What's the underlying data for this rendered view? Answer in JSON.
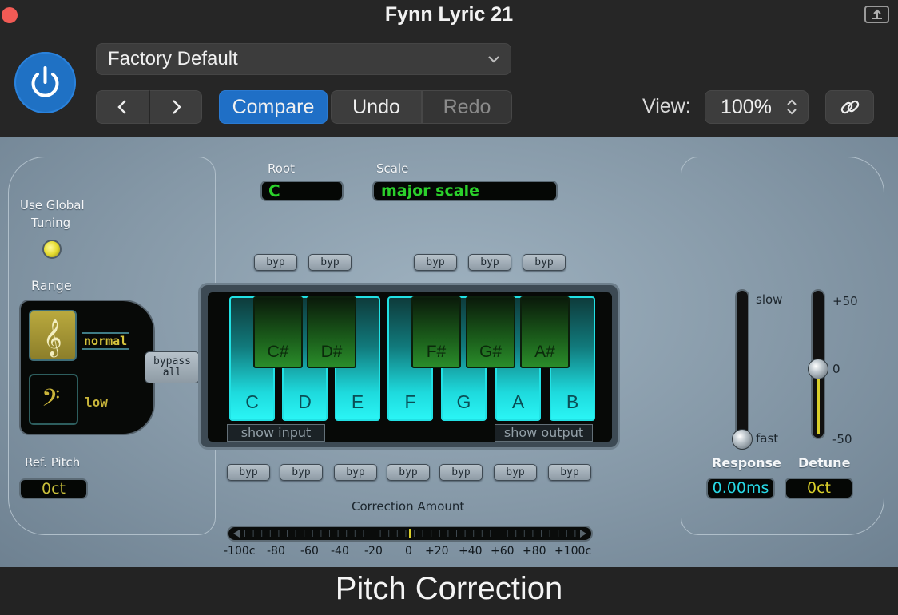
{
  "window": {
    "title": "Fynn Lyric 21"
  },
  "header": {
    "preset": "Factory Default",
    "compare_label": "Compare",
    "undo_label": "Undo",
    "redo_label": "Redo",
    "view_label": "View:",
    "zoom_value": "100%"
  },
  "plugin": {
    "name": "Pitch Correction",
    "root_label": "Root",
    "root_value": "C",
    "scale_label": "Scale",
    "scale_value": "major scale",
    "global_tuning_label_1": "Use Global",
    "global_tuning_label_2": "Tuning",
    "range_label": "Range",
    "range_normal": "normal",
    "range_low": "low",
    "ref_pitch_label": "Ref. Pitch",
    "ref_pitch_value": "0ct",
    "bypass_all_1": "bypass",
    "bypass_all_2": "all",
    "byp_label": "byp",
    "white_keys": [
      "C",
      "D",
      "E",
      "F",
      "G",
      "A",
      "B"
    ],
    "black_keys": [
      "C#",
      "D#",
      "F#",
      "G#",
      "A#"
    ],
    "show_input": "show input",
    "show_output": "show output",
    "response": {
      "label": "Response",
      "value": "0.00ms",
      "slow": "slow",
      "fast": "fast"
    },
    "detune": {
      "label": "Detune",
      "value": "0ct",
      "plus": "+50",
      "zero": "0",
      "minus": "-50"
    },
    "correction": {
      "label": "Correction Amount",
      "ticks": [
        "-100c",
        "-80",
        "-60",
        "-40",
        "-20",
        "0",
        "+20",
        "+40",
        "+60",
        "+80",
        "+100c"
      ]
    }
  },
  "colors": {
    "accent": "#1f6fc6",
    "lcd_green": "#2bd02b",
    "key_cyan": "#21e1e4",
    "led_yellow": "#e6dc30"
  }
}
